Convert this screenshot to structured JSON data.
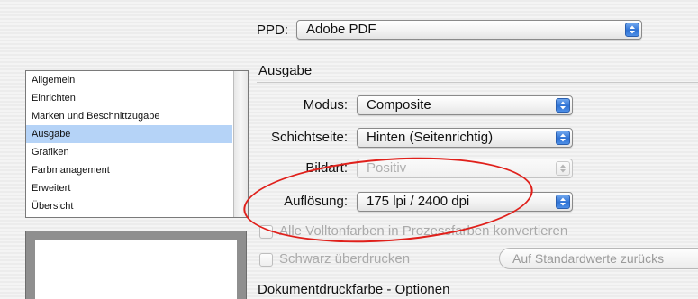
{
  "ppd": {
    "label": "PPD:",
    "value": "Adobe PDF"
  },
  "sidebar": {
    "items": [
      {
        "label": "Allgemein",
        "selected": false
      },
      {
        "label": "Einrichten",
        "selected": false
      },
      {
        "label": "Marken und Beschnittzugabe",
        "selected": false
      },
      {
        "label": "Ausgabe",
        "selected": true
      },
      {
        "label": "Grafiken",
        "selected": false
      },
      {
        "label": "Farbmanagement",
        "selected": false
      },
      {
        "label": "Erweitert",
        "selected": false
      },
      {
        "label": "Übersicht",
        "selected": false
      }
    ]
  },
  "section_title": "Ausgabe",
  "fields": {
    "modus": {
      "label": "Modus:",
      "value": "Composite"
    },
    "schichtseite": {
      "label": "Schichtseite:",
      "value": "Hinten (Seitenrichtig)"
    },
    "bildart": {
      "label": "Bildart:",
      "value": "Positiv"
    },
    "aufloesung": {
      "label": "Auflösung:",
      "value": "175 lpi / 2400 dpi"
    }
  },
  "checkboxes": {
    "volltonfarben": {
      "label": "Alle Volltonfarben in Prozessfarben konvertieren",
      "checked": false
    },
    "schwarz": {
      "label": "Schwarz überdrucken",
      "checked": false
    }
  },
  "options_title": "Dokumentdruckfarbe - Optionen",
  "reset_button": "Auf Standardwerte zurücks",
  "colors": {
    "selection": "#b5d3f7",
    "highlight_ellipse": "#e0201b",
    "popup_arrow": "#2f72d4"
  }
}
